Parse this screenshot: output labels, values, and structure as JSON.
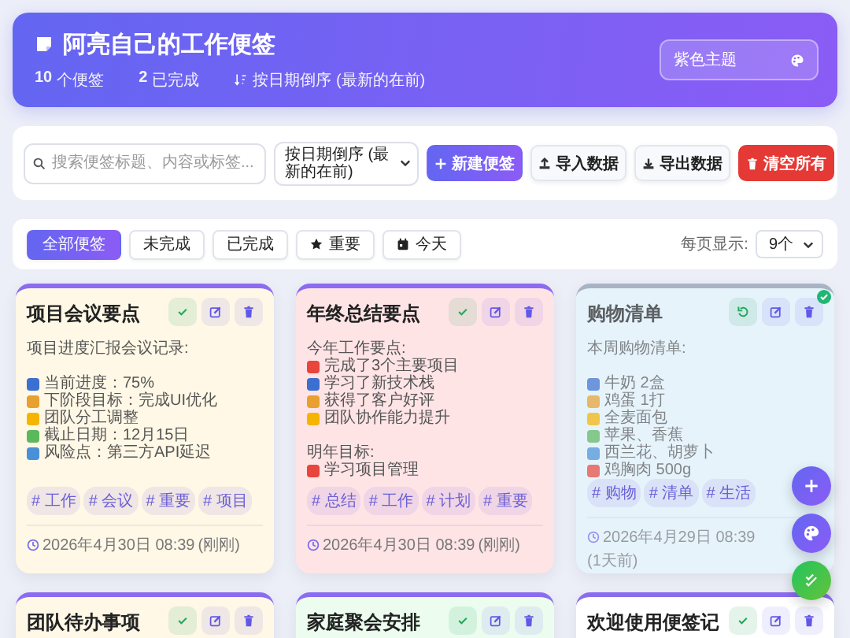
{
  "header": {
    "title": "阿亮自己的工作便签",
    "stats": [
      {
        "value": "10",
        "label": "个便签"
      },
      {
        "value": "2",
        "label": "已完成"
      }
    ],
    "sort_info": "按日期倒序 (最新的在前)",
    "theme_button": "紫色主题"
  },
  "toolbar": {
    "search": {
      "placeholder": "搜索便签标题、内容或标签..."
    },
    "sort_select": "按日期倒序 (最新的在前)",
    "buttons": [
      {
        "kind": "new",
        "label": "新建便签"
      },
      {
        "kind": "import",
        "label": "导入数据"
      },
      {
        "kind": "export",
        "label": "导出数据"
      },
      {
        "kind": "clear",
        "label": "清空所有"
      }
    ]
  },
  "filters": [
    {
      "kind": "all",
      "label": "全部便签",
      "selected": true
    },
    {
      "kind": "plain",
      "label": "未完成",
      "selected": false
    },
    {
      "kind": "plain",
      "label": "已完成",
      "selected": false
    },
    {
      "kind": "star",
      "label": "重要",
      "selected": false
    },
    {
      "kind": "calendar",
      "label": "今天",
      "selected": false
    }
  ],
  "per_page": {
    "label": "每页显示:",
    "value": "9个"
  },
  "notes": [
    {
      "title": "项目会议要点",
      "done": false,
      "color": "#fff8e6",
      "lines": [
        {
          "kind": "text",
          "text": "项目进度汇报会议记录:"
        },
        {
          "kind": "blank"
        },
        {
          "kind": "item",
          "text": "当前进度：75%"
        },
        {
          "kind": "item",
          "text": "下阶段目标：完成UI优化"
        },
        {
          "kind": "item",
          "text": "团队分工调整"
        },
        {
          "kind": "item",
          "text": "截止日期：12月15日"
        },
        {
          "kind": "item",
          "text": "风险点：第三方API延迟"
        }
      ],
      "tags": [
        "# 工作",
        "# 会议",
        "# 重要",
        "# 项目"
      ],
      "date": "2026年4月30日 08:39",
      "ago": "(刚刚)"
    },
    {
      "title": "年终总结要点",
      "done": false,
      "color": "#ffe4e6",
      "lines": [
        {
          "kind": "text",
          "text": "今年工作要点:"
        },
        {
          "kind": "item",
          "text": "完成了3个主要项目"
        },
        {
          "kind": "item",
          "text": "学习了新技术栈"
        },
        {
          "kind": "item",
          "text": "获得了客户好评"
        },
        {
          "kind": "item",
          "text": "团队协作能力提升"
        },
        {
          "kind": "blank"
        },
        {
          "kind": "text",
          "text": "明年目标:"
        },
        {
          "kind": "item",
          "text": "学习项目管理"
        }
      ],
      "tags": [
        "# 总结",
        "# 工作",
        "# 计划",
        "# 重要"
      ],
      "date": "2026年4月30日 08:39",
      "ago": "(刚刚)"
    },
    {
      "title": "购物清单",
      "done": true,
      "color": "#e6f3fb",
      "lines": [
        {
          "kind": "text",
          "text": "本周购物清单:"
        },
        {
          "kind": "blank"
        },
        {
          "kind": "item",
          "text": "牛奶 2盒"
        },
        {
          "kind": "item",
          "text": "鸡蛋 1打"
        },
        {
          "kind": "item",
          "text": "全麦面包"
        },
        {
          "kind": "item",
          "text": "苹果、香蕉"
        },
        {
          "kind": "item",
          "text": "西兰花、胡萝卜"
        },
        {
          "kind": "item",
          "text": "鸡胸肉 500g"
        }
      ],
      "tags": [
        "# 购物",
        "# 清单",
        "# 生活"
      ],
      "date": "2026年4月29日 08:39",
      "ago": "(1天前)"
    },
    {
      "title": "团队待办事项",
      "done": false,
      "color": "#fff8e6"
    },
    {
      "title": "家庭聚会安排",
      "done": false,
      "color": "#ecfdf0"
    },
    {
      "title": "欢迎使用便签记",
      "done": false,
      "color": "#ffffff"
    }
  ],
  "fab_buttons": [
    {
      "kind": "add"
    },
    {
      "kind": "theme"
    },
    {
      "kind": "done"
    }
  ]
}
